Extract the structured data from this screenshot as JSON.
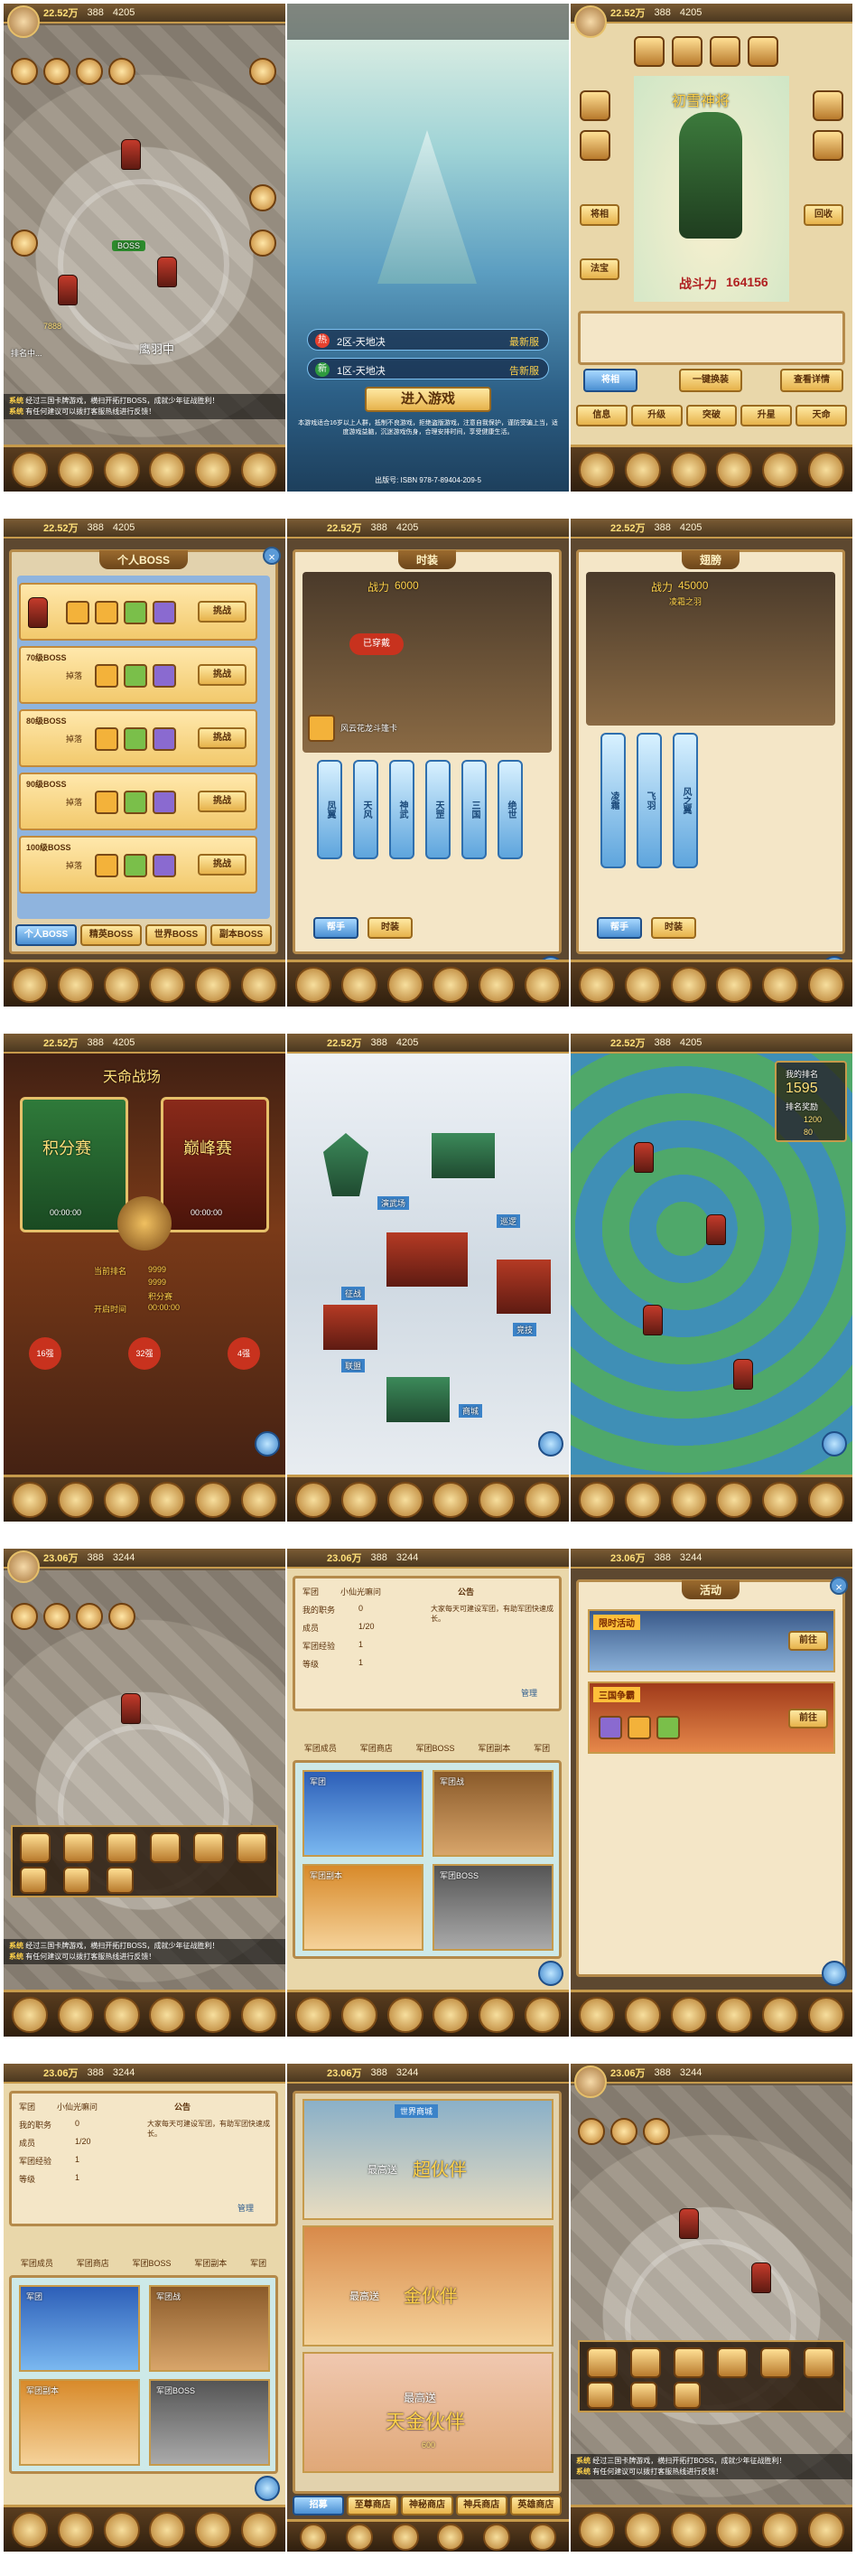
{
  "status": {
    "gold_a": "22.52万",
    "gems_a": "388",
    "coins_a": "4205",
    "gold_b": "23.06万",
    "gems_b": "388",
    "coins_b": "3244"
  },
  "chat": {
    "line1_tag": "系统",
    "line1": "经过三国卡牌游戏，横扫开拓打BOSS，成就少年征战胜利！",
    "line2_tag": "系统",
    "line2": "有任何建议可以拨打客服热线进行反馈！"
  },
  "row1": {
    "map": {
      "label_defeat": "排名中...",
      "boss_label": "BOSS",
      "score": "7888",
      "title": "鹰羽中"
    },
    "login": {
      "server1_tag": "热",
      "server1": "2区-天地决",
      "server1_status": "最新服",
      "server2_tag": "新",
      "server2": "1区-天地决",
      "server2_status": "告新服",
      "enter": "进入游戏",
      "notice": "本游戏适合16岁以上人群，抵制不良游戏，拒绝盗版游戏，注意自我保护，谨防受骗上当，适度游戏益脑，沉迷游戏伤身，合理安排时间，享受健康生活。",
      "isbn": "出版号: ISBN 978-7-89404-209-5"
    },
    "hero": {
      "name": "初雪神将",
      "power_label": "战斗力",
      "power": "164156",
      "tabs": [
        "将相",
        "一键换装",
        "查看详情"
      ],
      "left_btns": [
        "将相",
        "法宝"
      ],
      "right_btns": [
        "回收"
      ],
      "bottom": [
        "信息",
        "升级",
        "突破",
        "升星",
        "天命"
      ]
    }
  },
  "row2": {
    "boss": {
      "title": "个人BOSS",
      "levels": [
        "70级BOSS",
        "80级BOSS",
        "90级BOSS",
        "100级BOSS"
      ],
      "status": "掉落",
      "btn": "挑战",
      "tabs": [
        "个人BOSS",
        "精英BOSS",
        "世界BOSS",
        "副本BOSS"
      ]
    },
    "fashion": {
      "title": "时装",
      "power_label": "战力",
      "power": "6000",
      "item": "风云花龙斗篷卡",
      "wear": "已穿戴",
      "pillars": [
        "凤翼",
        "天风",
        "神武",
        "天罡",
        "三国",
        "绝世"
      ],
      "btns": [
        "帮手",
        "时装"
      ]
    },
    "wings": {
      "title": "翅膀",
      "power_label": "战力",
      "power": "45000",
      "level": "凌霜之羽",
      "pillars": [
        "凌霜",
        "飞羽",
        "风之翼"
      ],
      "btns": [
        "帮手",
        "时装"
      ]
    }
  },
  "row3": {
    "arena": {
      "title": "天命战场",
      "left": "积分赛",
      "right": "巅峰赛",
      "time_a": "00:00:00",
      "time_b": "00:00:00",
      "rank_label": "当前排名",
      "rank": "9999",
      "rank2": "9999",
      "score": "积分赛",
      "start": "开启时间",
      "start_time": "00:00:00",
      "stage_a": "16强",
      "stage_b": "32强",
      "stage_c": "4强"
    },
    "city": {
      "labels": [
        "演武场",
        "巡逻",
        "征战",
        "竞技",
        "联盟",
        "商城"
      ]
    },
    "world": {
      "rank_label": "我的排名",
      "rank": "1595",
      "reward_label": "排名奖励",
      "reward1": "1200",
      "reward2": "80"
    }
  },
  "row4": {
    "guild": {
      "leader_label": "军团",
      "leader": "小仙光嘛问",
      "rank_label": "我的职务",
      "rank": "0",
      "members_label": "成员",
      "members": "1/20",
      "exp_label": "军团经验",
      "exp": "1",
      "level_label": "等级",
      "level": "1",
      "notice_title": "公告",
      "notice": "大家每天可建设军团，有助军团快速成长。",
      "manage": "管理",
      "actions": [
        "军团成员",
        "军团商店",
        "军团BOSS",
        "军团副本",
        "军团"
      ],
      "cards": [
        "军团",
        "军团战",
        "军团副本",
        "军团BOSS"
      ]
    },
    "event": {
      "title": "活动",
      "card1": "限时活动",
      "card1_btn": "前往",
      "card2": "三国争霸",
      "card2_btn": "前往"
    }
  },
  "row5": {
    "shop": {
      "title": "世界商城",
      "banner1": "最高送",
      "banner1_big": "超伙伴",
      "banner2": "最高送",
      "banner2_big": "金伙伴",
      "banner3_small": "最高送",
      "banner3_big": "天金伙伴",
      "price": "600",
      "tabs": [
        "招募",
        "至尊商店",
        "神秘商店",
        "神兵商店",
        "英雄商店"
      ]
    }
  },
  "colors": {
    "gold": "#ffe07a",
    "panel": "#f4e6c7",
    "border": "#b58a4a",
    "blue": "#4a8fd2"
  }
}
